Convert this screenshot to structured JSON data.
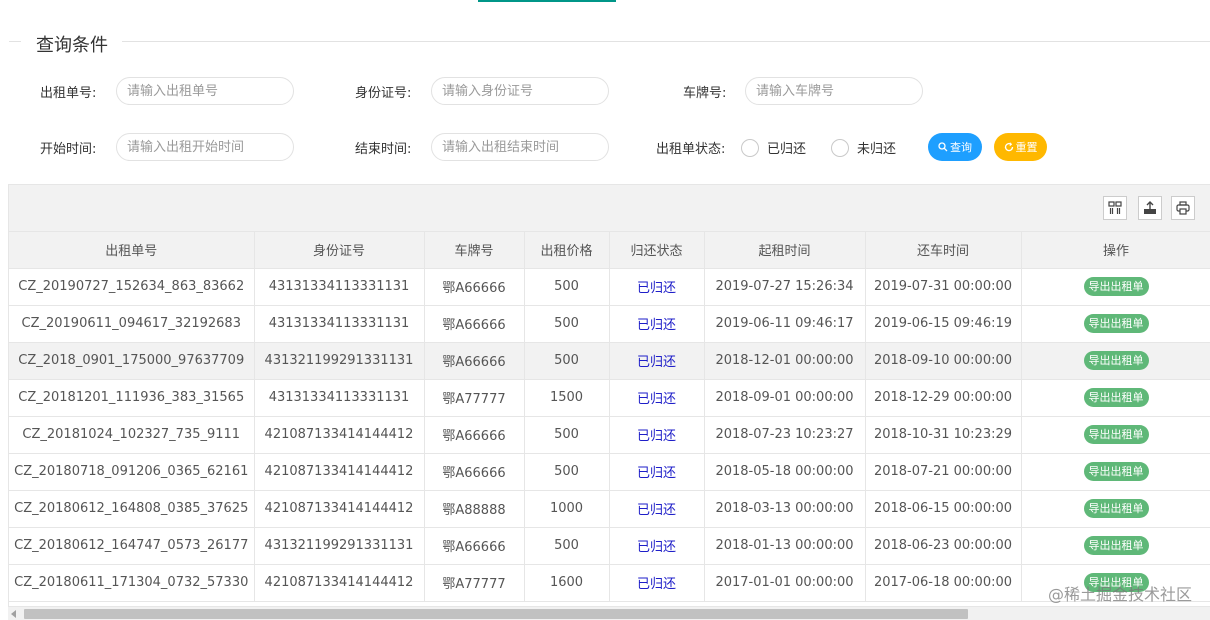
{
  "legend": "查询条件",
  "form": {
    "order_no_label": "出租单号:",
    "order_no_placeholder": "请输入出租单号",
    "id_no_label": "身份证号:",
    "id_no_placeholder": "请输入身份证号",
    "plate_label": "车牌号:",
    "plate_placeholder": "请输入车牌号",
    "start_label": "开始时间:",
    "start_placeholder": "请输入出租开始时间",
    "end_label": "结束时间:",
    "end_placeholder": "请输入出租结束时间",
    "status_label": "出租单状态:",
    "status_options": [
      "已归还",
      "未归还"
    ],
    "search_button": "查询",
    "reset_button": "重置"
  },
  "colors": {
    "accent": "#009688",
    "search_button": "#1e9fff",
    "reset_button": "#ffb800",
    "export_button": "#5fb878",
    "status_text": "#1e1ec8"
  },
  "toolbar_icons": [
    "columns-icon",
    "export-icon",
    "print-icon"
  ],
  "table": {
    "headers": [
      "出租单号",
      "身份证号",
      "车牌号",
      "出租价格",
      "归还状态",
      "起租时间",
      "还车时间",
      "操作"
    ],
    "rows": [
      [
        "CZ_20190727_152634_863_83662",
        "43131334113331131",
        "鄂A66666",
        "500",
        "已归还",
        "2019-07-27 15:26:34",
        "2019-07-31 00:00:00",
        "导出出租单"
      ],
      [
        "CZ_20190611_094617_32192683",
        "43131334113331131",
        "鄂A66666",
        "500",
        "已归还",
        "2019-06-11 09:46:17",
        "2019-06-15 09:46:19",
        "导出出租单"
      ],
      [
        "CZ_2018_0901_175000_97637709",
        "431321199291331131",
        "鄂A66666",
        "500",
        "已归还",
        "2018-12-01 00:00:00",
        "2018-09-10 00:00:00",
        "导出出租单"
      ],
      [
        "CZ_20181201_111936_383_31565",
        "43131334113331131",
        "鄂A77777",
        "1500",
        "已归还",
        "2018-09-01 00:00:00",
        "2018-12-29 00:00:00",
        "导出出租单"
      ],
      [
        "CZ_20181024_102327_735_9111",
        "421087133414144412",
        "鄂A66666",
        "500",
        "已归还",
        "2018-07-23 10:23:27",
        "2018-10-31 10:23:29",
        "导出出租单"
      ],
      [
        "CZ_20180718_091206_0365_62161",
        "421087133414144412",
        "鄂A66666",
        "500",
        "已归还",
        "2018-05-18 00:00:00",
        "2018-07-21 00:00:00",
        "导出出租单"
      ],
      [
        "CZ_20180612_164808_0385_37625",
        "421087133414144412",
        "鄂A88888",
        "1000",
        "已归还",
        "2018-03-13 00:00:00",
        "2018-06-15 00:00:00",
        "导出出租单"
      ],
      [
        "CZ_20180612_164747_0573_26177",
        "431321199291331131",
        "鄂A66666",
        "500",
        "已归还",
        "2018-01-13 00:00:00",
        "2018-06-23 00:00:00",
        "导出出租单"
      ],
      [
        "CZ_20180611_171304_0732_57330",
        "421087133414144412",
        "鄂A77777",
        "1600",
        "已归还",
        "2017-01-01 00:00:00",
        "2017-06-18 00:00:00",
        "导出出租单"
      ]
    ]
  },
  "watermark": "@稀土掘金技术社区"
}
